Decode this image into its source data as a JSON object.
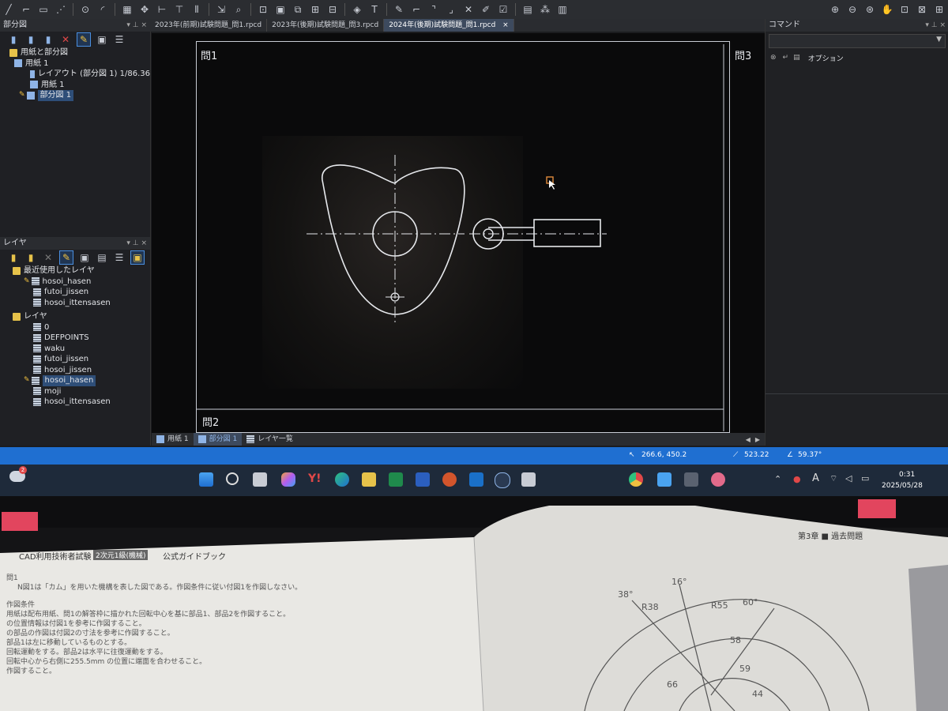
{
  "tabs": [
    "2023年(前期)試験問題_問1.rpcd",
    "2023年(後期)試験問題_問3.rpcd",
    "2024年(後期)試験問題_問1.rpcd"
  ],
  "tab_close": "×",
  "left_panel": {
    "title": "部分図",
    "tree": [
      "用紙と部分図",
      "用紙 1",
      "レイアウト (部分図 1)  1/86.36",
      "用紙 1",
      "部分図 1"
    ]
  },
  "layer_panel": {
    "title": "レイヤ",
    "recent_title": "最近使用したレイヤ",
    "recent": [
      "hosoi_hasen",
      "futoi_jissen",
      "hosoi_ittensasen"
    ],
    "layers_title": "レイヤ",
    "layers": [
      "0",
      "DEFPOINTS",
      "waku",
      "futoi_jissen",
      "hosoi_jissen",
      "hosoi_hasen",
      "moji",
      "hosoi_ittensasen"
    ]
  },
  "panel_ctrl": "▾ ⊥ ×",
  "canvas": {
    "zone_tl": "問1",
    "zone_tr": "問3",
    "zone_bl": "問2"
  },
  "command_panel": {
    "title": "コマンド",
    "options_label": "オプション"
  },
  "bottom_tabs": [
    "用紙 1",
    "部分図 1",
    "レイヤ一覧"
  ],
  "status": {
    "coords": "266.6, 450.2",
    "length": "523.22",
    "angle": "59.37°"
  },
  "taskbar": {
    "time": "0:31",
    "date": "2025/05/28",
    "notif": "2",
    "ime": "A"
  },
  "book": {
    "left_header": "CAD利用技術者試験",
    "left_badge": "2次元1級(機械)",
    "left_header2": "公式ガイドブック",
    "right_header": "第3章 ■ 過去問題",
    "q_title": "問1",
    "q_line1": "N図1は「カム」を用いた機構を表した図である。作図条件に従い付図1を作図しなさい。",
    "cond_title": "作図条件",
    "conds": [
      "用紙は配布用紙、問1の解答枠に描かれた回転中心を基に部品1、部品2を作図すること。",
      "の位置情報は付図1を参考に作図すること。",
      "の部品の作図は付図2の寸法を参考に作図すること。",
      "部品1は左に移動しているものとする。",
      "回転運動をする。部品2は水平に往復運動をする。",
      "回転中心から右側に255.5mm の位置に端面を合わせること。",
      "作図すること。"
    ],
    "dims": [
      "38°",
      "16°",
      "60°",
      "R38",
      "R55",
      "58",
      "59",
      "66",
      "44"
    ]
  },
  "colors": {
    "accent": "#1f6fd1",
    "tag": "#e2455e",
    "canvas_bg": "#0a0a0b",
    "line": "#e6e8ec"
  }
}
